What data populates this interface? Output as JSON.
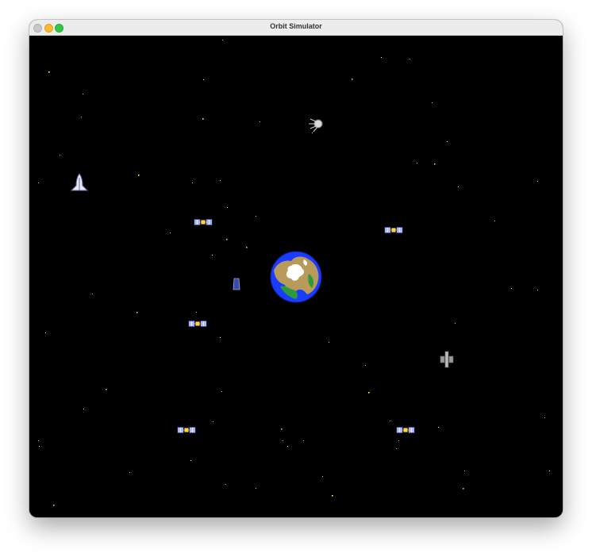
{
  "window": {
    "title": "Orbit Simulator",
    "controls": [
      "close",
      "minimize",
      "maximize"
    ]
  },
  "scene": {
    "background_color": "#000000",
    "star_color": "#ffff66",
    "planet": {
      "name": "earth-icon",
      "ocean_color": "#1a3cff",
      "land_color": "#b89a5a",
      "ice_color": "#ffffff"
    },
    "objects": [
      {
        "kind": "satellite",
        "icon": "satellite-icon"
      },
      {
        "kind": "satellite",
        "icon": "satellite-icon"
      },
      {
        "kind": "satellite",
        "icon": "satellite-icon"
      },
      {
        "kind": "satellite",
        "icon": "satellite-icon"
      },
      {
        "kind": "satellite",
        "icon": "satellite-icon"
      },
      {
        "kind": "space-shuttle",
        "icon": "space-shuttle-icon"
      },
      {
        "kind": "sputnik",
        "icon": "sputnik-icon"
      },
      {
        "kind": "space-station",
        "icon": "space-station-icon"
      },
      {
        "kind": "capsule",
        "icon": "capsule-icon"
      }
    ]
  }
}
